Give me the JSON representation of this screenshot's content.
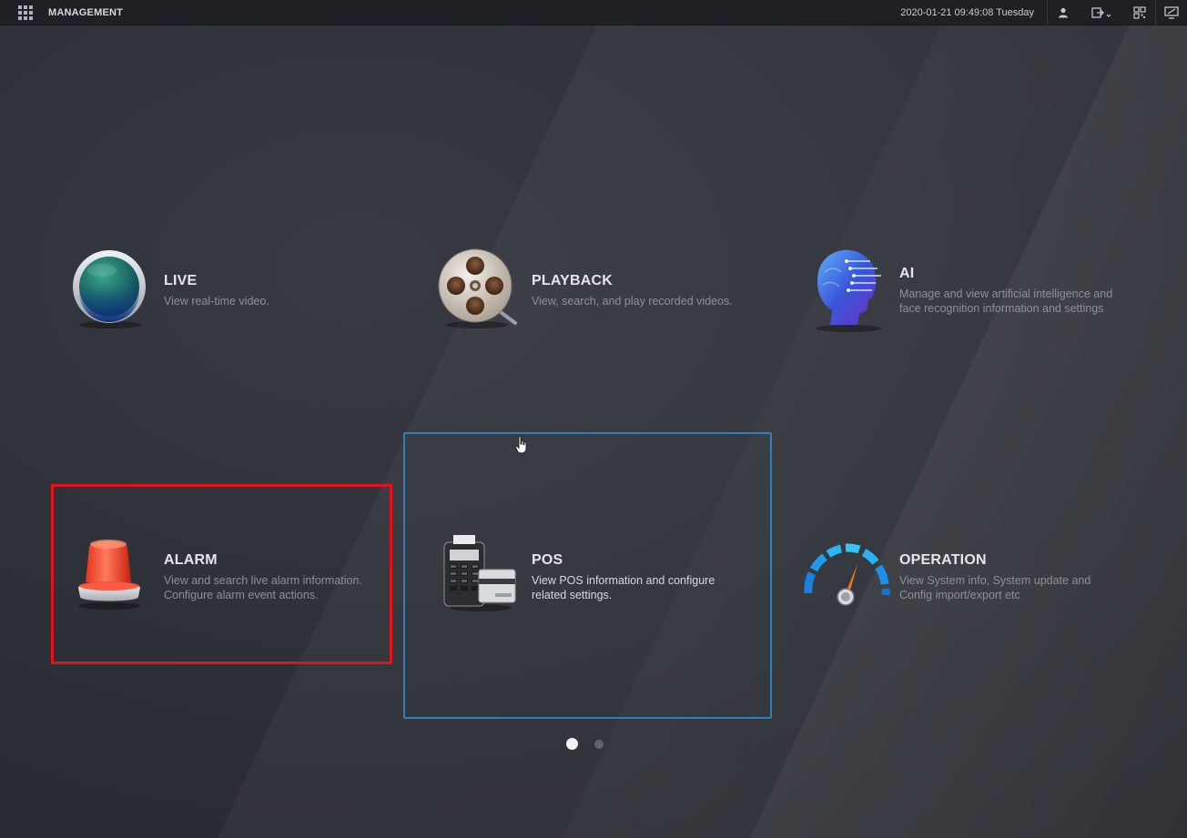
{
  "topbar": {
    "title": "MANAGEMENT",
    "datetime": "2020-01-21 09:49:08 Tuesday",
    "icons": [
      "user-icon",
      "logout-icon",
      "qrcode-icon",
      "display-icon"
    ]
  },
  "tiles": [
    {
      "id": "live",
      "title": "LIVE",
      "desc": [
        "View real-time video."
      ],
      "icon": "live-globe-icon"
    },
    {
      "id": "playback",
      "title": "PLAYBACK",
      "desc": [
        "View, search, and play recorded videos."
      ],
      "icon": "film-reel-icon"
    },
    {
      "id": "ai",
      "title": "AI",
      "desc": [
        "Manage and view artificial intelligence and",
        "face recognition information and settings"
      ],
      "icon": "ai-head-icon"
    },
    {
      "id": "alarm",
      "title": "ALARM",
      "desc": [
        "View and search live alarm information.",
        "Configure alarm event actions."
      ],
      "icon": "alarm-siren-icon"
    },
    {
      "id": "pos",
      "title": "POS",
      "desc": [
        "View POS information and configure",
        "related settings."
      ],
      "icon": "pos-terminal-icon"
    },
    {
      "id": "operation",
      "title": "OPERATION",
      "desc": [
        "View System info, System update and",
        "Config import/export etc"
      ],
      "icon": "gauge-icon"
    }
  ],
  "pagination": {
    "current": 1,
    "total": 2
  },
  "colors": {
    "highlight": "#e5121a",
    "selection": "#2f7fb8"
  }
}
